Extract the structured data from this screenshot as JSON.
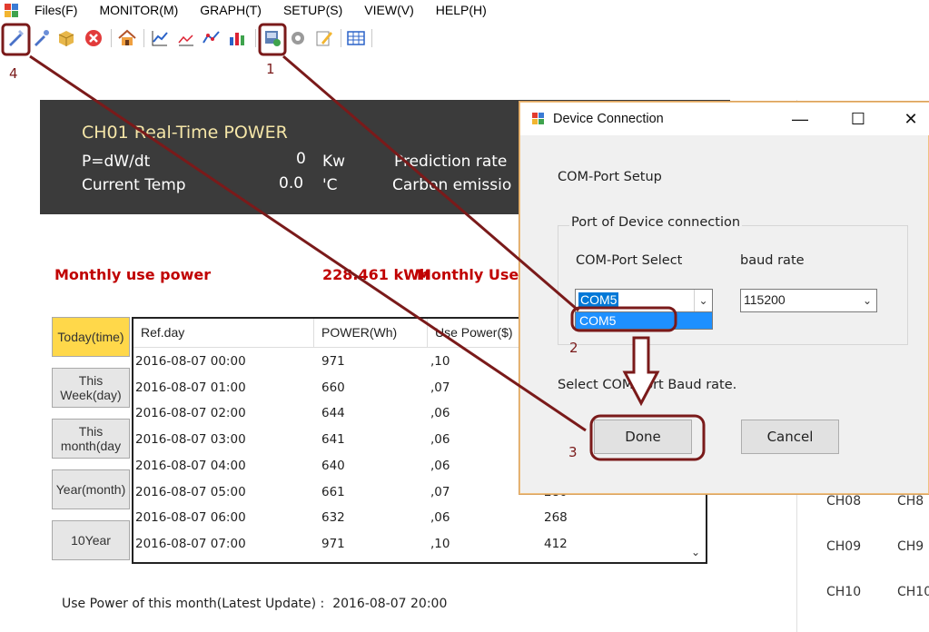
{
  "menu": {
    "items": [
      "Files(F)",
      "MONITOR(M)",
      "GRAPH(T)",
      "SETUP(S)",
      "VIEW(V)",
      "HELP(H)"
    ]
  },
  "toolbar": {
    "icons": [
      "connect-icon",
      "disconnect-icon",
      "package-icon",
      "stop-icon",
      "home-icon",
      "graph-icon",
      "trend-icon",
      "line-icon",
      "bar-chart-icon",
      "device-connection-icon",
      "settings-icon",
      "edit-icon",
      "table-icon"
    ]
  },
  "panel": {
    "title": "CH01  Real-Time POWER",
    "row1_label": "P=dW/dt",
    "row1_value": "0",
    "row1_unit": "Kw",
    "row1_right": "Prediction rate",
    "row2_label": "Current Temp",
    "row2_value": "0.0",
    "row2_unit": "'C",
    "row2_right": "Carbon emissio"
  },
  "monthly": {
    "label": "Monthly use power",
    "value": "228.461 kWh",
    "use_label": "Monthly Use"
  },
  "side_buttons": [
    "Today(time)",
    "This Week(day)",
    "This month(day",
    "Year(month)",
    "10Year"
  ],
  "table": {
    "headers": [
      "Ref.day",
      "POWER(Wh)",
      "Use Power($)"
    ],
    "rows": [
      [
        "2016-08-07 00:00",
        "971",
        ",10",
        ""
      ],
      [
        "2016-08-07 01:00",
        "660",
        ",07",
        ""
      ],
      [
        "2016-08-07 02:00",
        "644",
        ",06",
        ""
      ],
      [
        "2016-08-07 03:00",
        "641",
        ",06",
        ""
      ],
      [
        "2016-08-07 04:00",
        "640",
        ",06",
        ""
      ],
      [
        "2016-08-07 05:00",
        "661",
        ",07",
        "280"
      ],
      [
        "2016-08-07 06:00",
        "632",
        ",06",
        "268"
      ],
      [
        "2016-08-07 07:00",
        "971",
        ",10",
        "412"
      ]
    ]
  },
  "footer": {
    "label": "Use Power of this month(Latest Update) :",
    "value": "2016-08-07 20:00"
  },
  "channels": [
    {
      "a": "CH08",
      "b": "CH8"
    },
    {
      "a": "CH09",
      "b": "CH9"
    },
    {
      "a": "CH10",
      "b": "CH10"
    }
  ],
  "dialog": {
    "title": "Device Connection",
    "minimize": "—",
    "maximize": "☐",
    "close": "✕",
    "section": "COM-Port Setup",
    "group_label": "Port of Device connection",
    "com_label": "COM-Port Select",
    "baud_label": "baud rate",
    "com_value": "COM5",
    "baud_value": "115200",
    "dropdown_option": "COM5",
    "hint": "Select COM Port  Baud rate.",
    "done": "Done",
    "cancel": "Cancel"
  },
  "annotations": {
    "n1": "1",
    "n2": "2",
    "n3": "3",
    "n4": "4",
    "color": "#7a1a1a"
  }
}
